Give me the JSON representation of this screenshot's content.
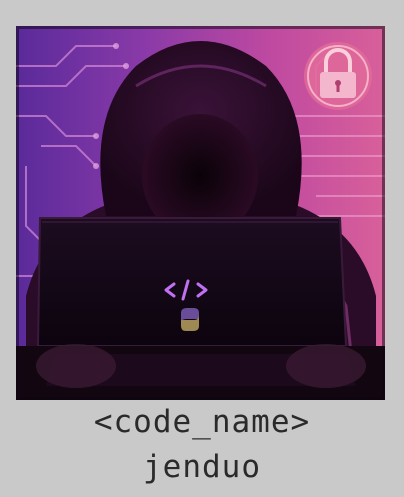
{
  "card": {
    "photo_subject": "hooded-hacker-with-laptop",
    "palette": {
      "background": "#c9c9c9",
      "magenta": "#d04bb8",
      "violet": "#6a2fa8",
      "dark": "#140818",
      "text": "#2a2a2a"
    },
    "caption_label": "<code_name>",
    "caption_value": "jenduo"
  }
}
